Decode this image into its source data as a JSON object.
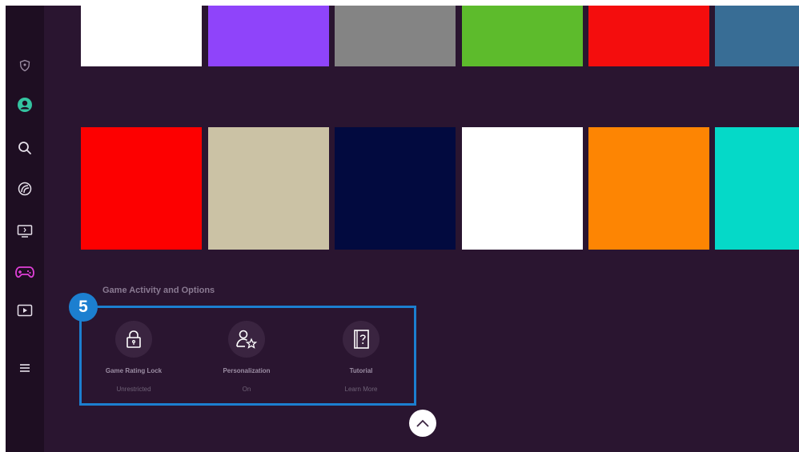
{
  "sidebar": {
    "items": [
      {
        "icon": "shield-icon"
      },
      {
        "icon": "profile-icon"
      },
      {
        "icon": "search-icon"
      },
      {
        "icon": "ambient-icon"
      },
      {
        "icon": "tv-screen-icon"
      },
      {
        "icon": "gamepad-icon"
      },
      {
        "icon": "media-play-icon"
      },
      {
        "icon": "menu-icon"
      }
    ]
  },
  "tiles_row1": [
    "#ffffff",
    "#8f44fa",
    "#848484",
    "#5dbb2c",
    "#f40d0d",
    "#386d95"
  ],
  "tiles_row2": [
    "#fd0000",
    "#cbc2a5",
    "#020a3f",
    "#ffffff",
    "#fd8503",
    "#05d9c8"
  ],
  "game_section": {
    "title": "Game Activity and Options",
    "badge": "5",
    "options": [
      {
        "icon": "lock-icon",
        "label": "Game Rating Lock",
        "value": "Unrestricted"
      },
      {
        "icon": "person-star-icon",
        "label": "Personalization",
        "value": "On"
      },
      {
        "icon": "help-book-icon",
        "label": "Tutorial",
        "value": "Learn More"
      }
    ]
  },
  "colors": {
    "background": "#2a1530",
    "sidebar": "#1e0e22",
    "focus": "#1c7fd0",
    "active_icon": "#e040d8"
  }
}
